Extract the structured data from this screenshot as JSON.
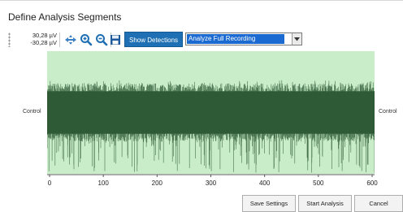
{
  "window": {
    "title": "Define Analysis Segments"
  },
  "toolbar": {
    "scale_top": "30,28 µV",
    "scale_bottom": "-30,28 µV",
    "icons": [
      "move-axis-icon",
      "zoom-in-icon",
      "zoom-out-icon",
      "save-icon"
    ],
    "show_detections_label": "Show Detections",
    "segment_select_value": "Analyze Full Recording"
  },
  "plot": {
    "channel_label_left": "Control",
    "channel_label_right": "Control",
    "background_color": "#c8edc8",
    "signal_color": "#2f5a36"
  },
  "chart_data": {
    "type": "line",
    "title": "",
    "xlabel": "",
    "ylabel": "",
    "xlim": [
      0,
      600
    ],
    "ylim": [
      -30.28,
      30.28
    ],
    "x_ticks": [
      "0",
      "100",
      "200",
      "300",
      "400",
      "500",
      "600"
    ],
    "series": [
      {
        "trace": "continuous raw voltage trace, dense band roughly -10 to +10 µV with sparse negative spikes down to about -30 µV across the full recording"
      }
    ]
  },
  "buttons": {
    "save_settings": "Save Settings",
    "start_analysis": "Start Analysis",
    "cancel": "Cancel"
  }
}
